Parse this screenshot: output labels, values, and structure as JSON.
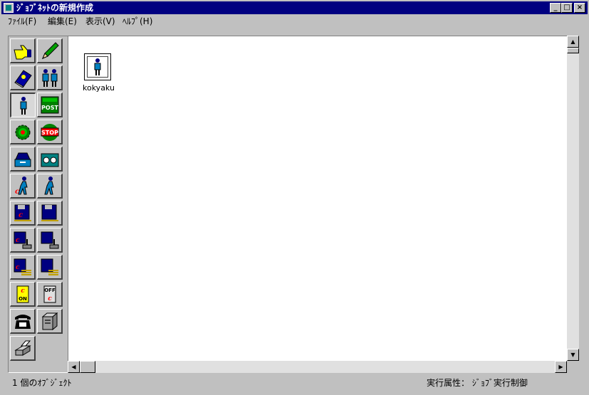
{
  "window": {
    "title": "ｼﾞｮﾌﾞﾈｯﾄの新規作成",
    "controls": {
      "minimize": "_",
      "maximize": "□",
      "close": "×"
    }
  },
  "menu": {
    "items": [
      {
        "label": "ﾌｧｲﾙ(F)"
      },
      {
        "label": "編集(E)"
      },
      {
        "label": "表示(V)"
      },
      {
        "label": "ﾍﾙﾌﾟ(H)"
      }
    ]
  },
  "toolbox": {
    "tools": [
      {
        "icon": "pointer-hand-icon"
      },
      {
        "icon": "pencil-icon"
      },
      {
        "icon": "book-icon"
      },
      {
        "icon": "two-persons-icon"
      },
      {
        "icon": "person-icon"
      },
      {
        "icon": "post-icon",
        "text": "POST"
      },
      {
        "icon": "gear-icon"
      },
      {
        "icon": "stop-icon",
        "text": "STOP"
      },
      {
        "icon": "tray-icon"
      },
      {
        "icon": "tape-recorder-icon"
      },
      {
        "icon": "walking-person-c-icon"
      },
      {
        "icon": "walking-person-icon"
      },
      {
        "icon": "floppy-c-icon"
      },
      {
        "icon": "floppy-icon"
      },
      {
        "icon": "floppy-joystick-c-icon"
      },
      {
        "icon": "floppy-joystick-icon"
      },
      {
        "icon": "floppy-lines-c-icon"
      },
      {
        "icon": "floppy-lines-icon"
      },
      {
        "icon": "switch-on-icon",
        "text": "ON"
      },
      {
        "icon": "switch-off-icon",
        "text": "OFF"
      },
      {
        "icon": "telephone-icon"
      },
      {
        "icon": "server-icon"
      },
      {
        "icon": "printer-icon"
      }
    ]
  },
  "canvas": {
    "objects": [
      {
        "icon": "person-icon",
        "label": "kokyaku"
      }
    ]
  },
  "statusbar": {
    "left": "1 個のｵﾌﾞｼﾞｪｸﾄ",
    "right": "実行属性： ｼﾞｮﾌﾞ実行制御"
  },
  "colors": {
    "title_bar": "#000080",
    "face": "#c0c0c0",
    "canvas": "#ffffff"
  }
}
